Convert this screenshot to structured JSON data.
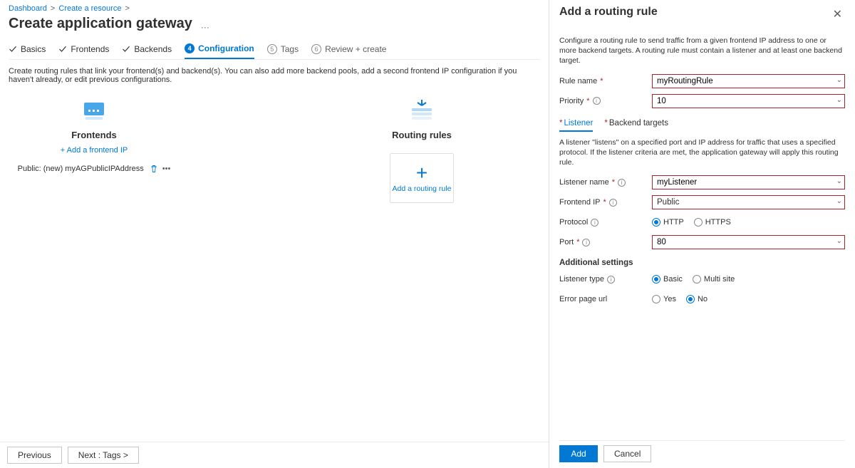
{
  "breadcrumb": {
    "item1": "Dashboard",
    "item2": "Create a resource"
  },
  "page_title": "Create application gateway",
  "tabs": {
    "basics": "Basics",
    "frontends": "Frontends",
    "backends": "Backends",
    "configuration": "Configuration",
    "tags_num": "5",
    "tags": "Tags",
    "review_num": "6",
    "review": "Review + create",
    "config_num": "4"
  },
  "desc": "Create routing rules that link your frontend(s) and backend(s). You can also add more backend pools, add a second frontend IP configuration if you haven't already, or edit previous configurations.",
  "columns": {
    "frontends": {
      "title": "Frontends",
      "add_label": "+ Add a frontend IP",
      "item": "Public: (new) myAGPublicIPAddress"
    },
    "rules": {
      "title": "Routing rules",
      "add_tile": "Add a routing rule"
    }
  },
  "footer": {
    "prev": "Previous",
    "next": "Next : Tags >"
  },
  "panel": {
    "title": "Add a routing rule",
    "desc": "Configure a routing rule to send traffic from a given frontend IP address to one or more backend targets. A routing rule must contain a listener and at least one backend target.",
    "rule_name_label": "Rule name",
    "rule_name_value": "myRoutingRule",
    "priority_label": "Priority",
    "priority_value": "10",
    "subtabs": {
      "listener": "Listener",
      "backend": "Backend targets"
    },
    "listener_desc": "A listener \"listens\" on a specified port and IP address for traffic that uses a specified protocol. If the listener criteria are met, the application gateway will apply this routing rule.",
    "listener_name_label": "Listener name",
    "listener_name_value": "myListener",
    "frontend_ip_label": "Frontend IP",
    "frontend_ip_value": "Public",
    "protocol_label": "Protocol",
    "protocol_http": "HTTP",
    "protocol_https": "HTTPS",
    "port_label": "Port",
    "port_value": "80",
    "additional_header": "Additional settings",
    "listener_type_label": "Listener type",
    "lt_basic": "Basic",
    "lt_multi": "Multi site",
    "error_page_label": "Error page url",
    "ep_yes": "Yes",
    "ep_no": "No",
    "add_btn": "Add",
    "cancel_btn": "Cancel"
  }
}
